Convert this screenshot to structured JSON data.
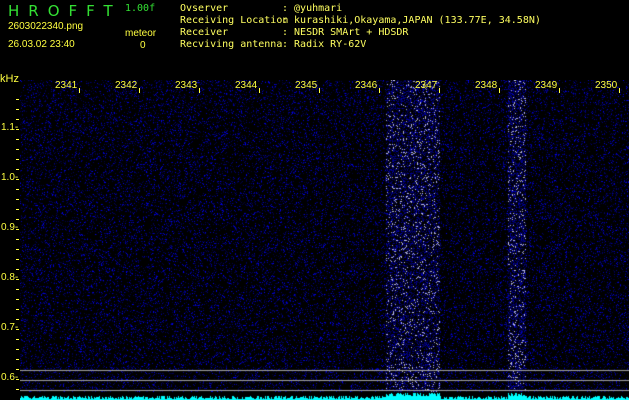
{
  "header": {
    "app_title": "HROFFT",
    "version": "1.00f",
    "filename": "2603022340.png",
    "datetime": "26.03.02 23:40",
    "meteor_label": "meteor",
    "meteor_count": "0"
  },
  "info": [
    {
      "label": "Ovserver",
      "value": ": @yuhmari"
    },
    {
      "label": "Receiving Location",
      "value": ": kurashiki,Okayama,JAPAN (133.77E, 34.58N)"
    },
    {
      "label": "Receiver",
      "value": ": NESDR SMArt + HDSDR"
    },
    {
      "label": "Recviving antenna",
      "value": ": Radix RY-62V"
    }
  ],
  "chart_data": {
    "type": "heatmap",
    "y_unit": "kHz",
    "x_ticks": [
      "2341",
      "2342",
      "2343",
      "2344",
      "2345",
      "2346",
      "2347",
      "2348",
      "2349",
      "2350"
    ],
    "y_ticks": [
      "1.1",
      "1.0",
      "0.9",
      "0.8",
      "0.7",
      "0.6"
    ],
    "colors": {
      "background": "#000000",
      "noise": "#1a1aff",
      "spectrum": "#00ffff",
      "labels": "#ffff40",
      "markers": "#a0a0a0"
    }
  }
}
